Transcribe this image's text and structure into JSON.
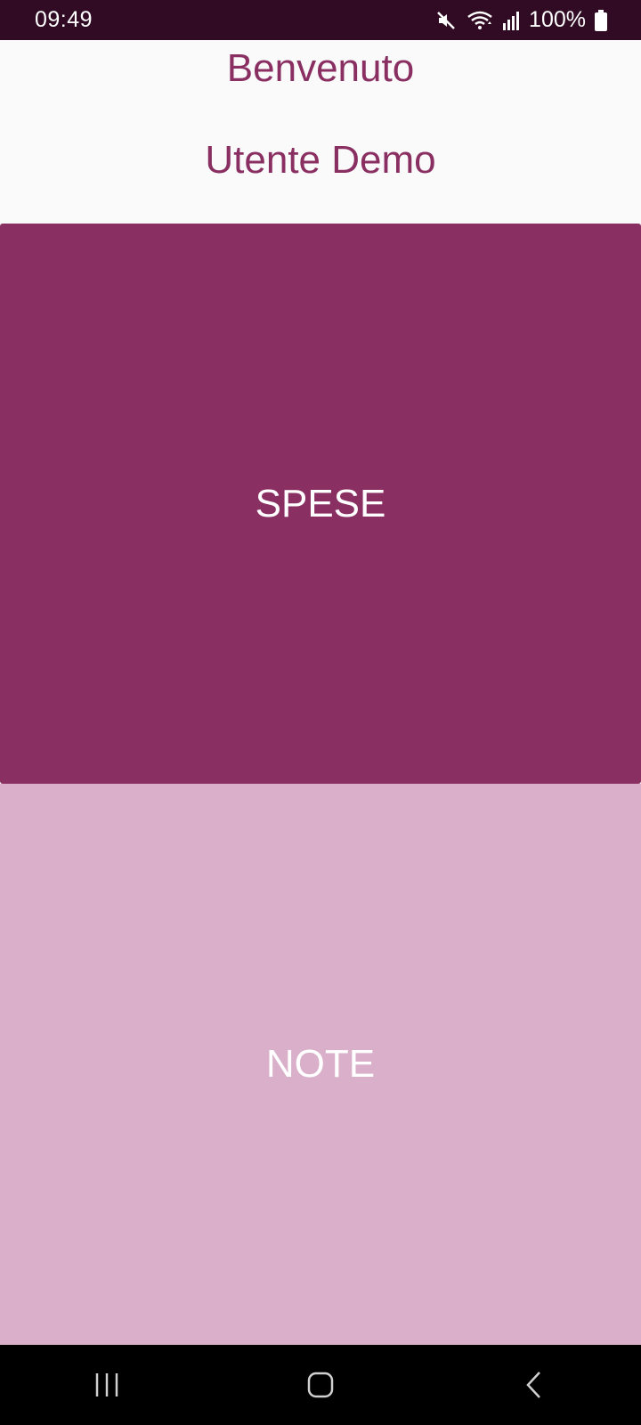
{
  "status_bar": {
    "time": "09:49",
    "battery": "100%",
    "icons": [
      "mute-icon",
      "wifi-icon",
      "signal-icon",
      "battery-icon"
    ]
  },
  "header": {
    "welcome": "Benvenuto",
    "user_name": "Utente Demo"
  },
  "tiles": {
    "spese_label": "SPESE",
    "note_label": "NOTE"
  },
  "nav_bar": {
    "icons": [
      "recent-apps-icon",
      "home-icon",
      "back-icon"
    ]
  },
  "colors": {
    "status_bar_bg": "#300b23",
    "accent": "#8a2f62",
    "secondary_tile": "#d9afc9",
    "background": "#fafafa"
  }
}
